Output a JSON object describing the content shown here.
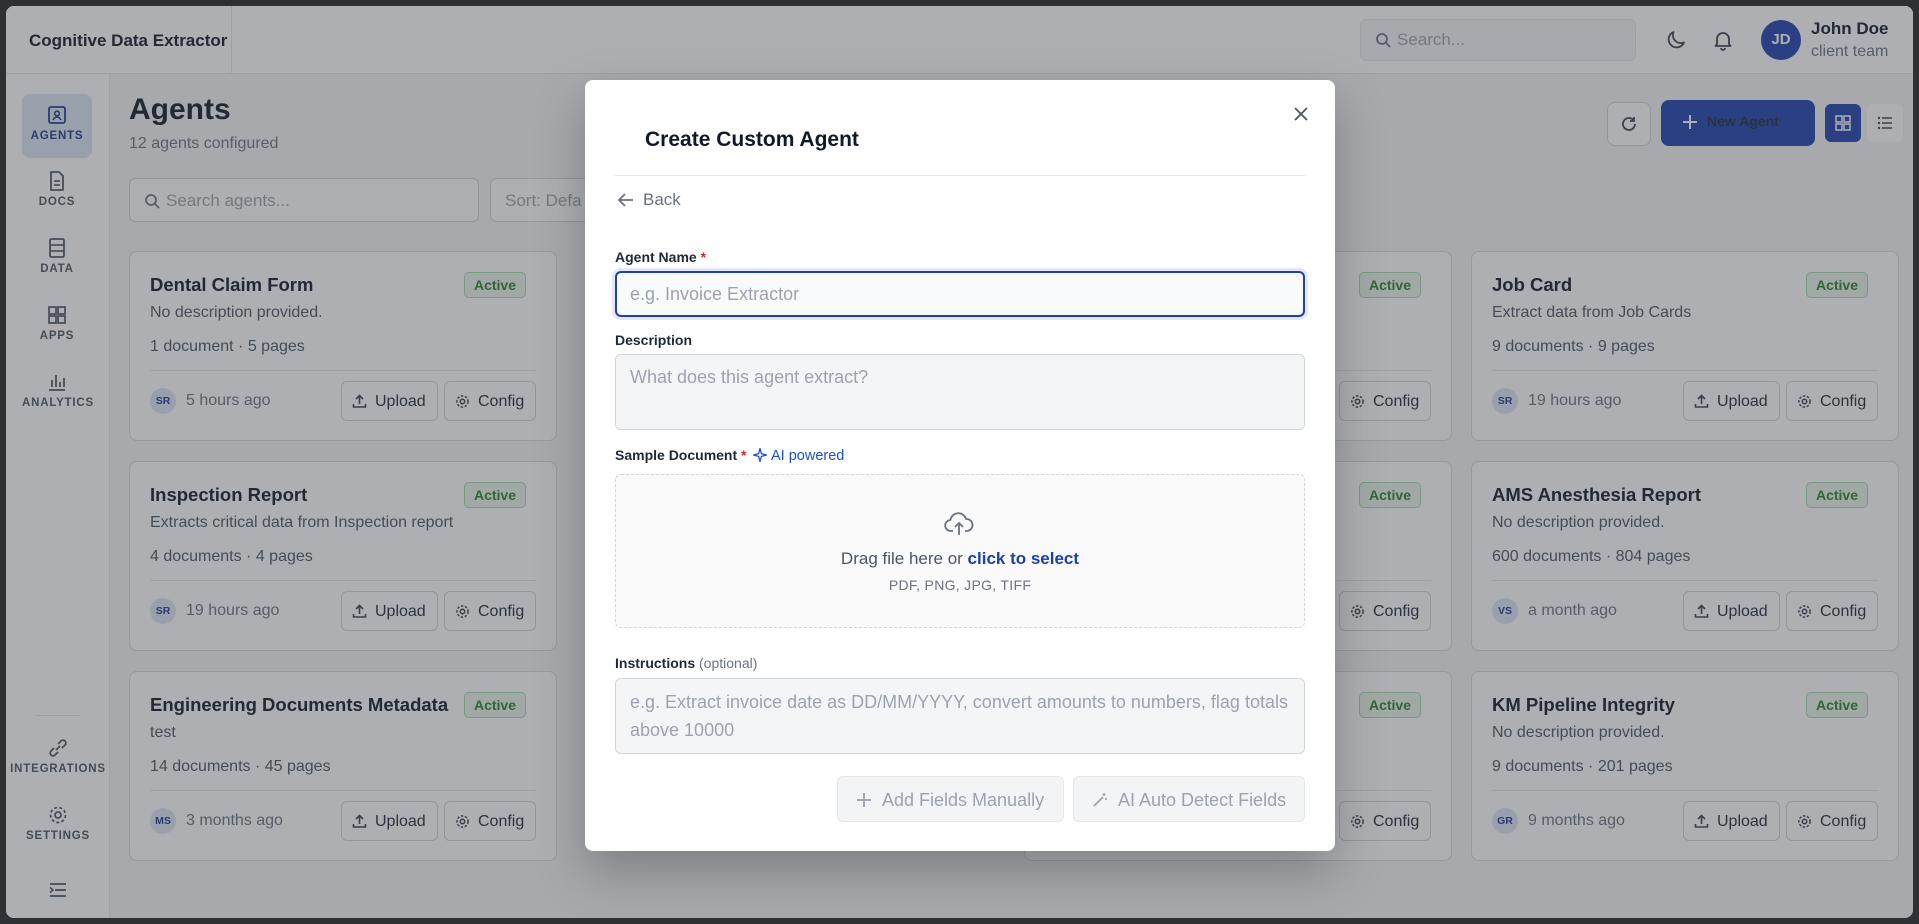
{
  "app": {
    "title": "Cognitive Data Extractor"
  },
  "header": {
    "search_placeholder": "Search...",
    "user": {
      "initials": "JD",
      "name": "John Doe",
      "team": "client team"
    }
  },
  "sidebar": {
    "items": [
      {
        "label": "AGENTS",
        "icon": "agents-icon",
        "active": true
      },
      {
        "label": "DOCS",
        "icon": "docs-icon"
      },
      {
        "label": "DATA",
        "icon": "data-icon"
      },
      {
        "label": "APPS",
        "icon": "apps-icon"
      },
      {
        "label": "ANALYTICS",
        "icon": "analytics-icon"
      }
    ],
    "bottom_items": [
      {
        "label": "INTEGRATIONS",
        "icon": "integrations-icon"
      },
      {
        "label": "SETTINGS",
        "icon": "settings-icon"
      }
    ]
  },
  "page": {
    "title": "Agents",
    "subtitle": "12 agents configured",
    "new_agent_label": "New Agent",
    "search_placeholder": "Search agents...",
    "sort_label": "Sort: Defa"
  },
  "cards": [
    {
      "title": "Dental Claim Form",
      "status": "Active",
      "description": "No description provided.",
      "meta": "1 document · 5 pages",
      "initials": "SR",
      "time": "5 hours ago",
      "upload": "Upload",
      "config": "Config"
    },
    {
      "title": "Job Card",
      "status": "Active",
      "description": "Extract data from Job Cards",
      "meta": "9 documents · 9 pages",
      "initials": "SR",
      "time": "19 hours ago",
      "upload": "Upload",
      "config": "Config"
    },
    {
      "title": "Inspection Report",
      "status": "Active",
      "description": "Extracts critical data from Inspection report",
      "meta": "4 documents · 4 pages",
      "initials": "SR",
      "time": "19 hours ago",
      "upload": "Upload",
      "config": "Config"
    },
    {
      "title": "AMS Anesthesia Report",
      "status": "Active",
      "description": "No description provided.",
      "meta": "600 documents · 804 pages",
      "initials": "VS",
      "time": "a month ago",
      "upload": "Upload",
      "config": "Config"
    },
    {
      "title": "Engineering Documents Metadata",
      "status": "Active",
      "description": "test",
      "meta": "14 documents · 45 pages",
      "initials": "MS",
      "time": "3 months ago",
      "upload": "Upload",
      "config": "Config"
    },
    {
      "title": "KM Pipeline Integrity",
      "status": "Active",
      "description": "No description provided.",
      "meta": "9 documents · 201 pages",
      "initials": "GR",
      "time": "9 months ago",
      "upload": "Upload",
      "config": "Config"
    },
    {
      "status": "Active",
      "config": "Config"
    },
    {
      "status": "Active",
      "config": "Config"
    },
    {
      "status": "Active",
      "config": "Config"
    }
  ],
  "modal": {
    "title": "Create Custom Agent",
    "back_label": "Back",
    "agent_name_label": "Agent Name",
    "agent_name_placeholder": "e.g. Invoice Extractor",
    "required_mark": "*",
    "description_label": "Description",
    "description_placeholder": "What does this agent extract?",
    "sample_label": "Sample Document",
    "ai_powered": "AI powered",
    "drop_text": "Drag file here or ",
    "drop_link": "click to select",
    "drop_formats": "PDF, PNG, JPG, TIFF",
    "instructions_label": "Instructions",
    "instructions_optional": "(optional)",
    "instructions_placeholder": "e.g. Extract invoice date as DD/MM/YYYY, convert amounts to numbers, flag totals above 10000",
    "add_fields_label": "Add Fields Manually",
    "auto_detect_label": "AI Auto Detect Fields"
  },
  "colors": {
    "primary": "#1e40af",
    "active_badge": "#2e7d32",
    "required": "#dc2626"
  }
}
